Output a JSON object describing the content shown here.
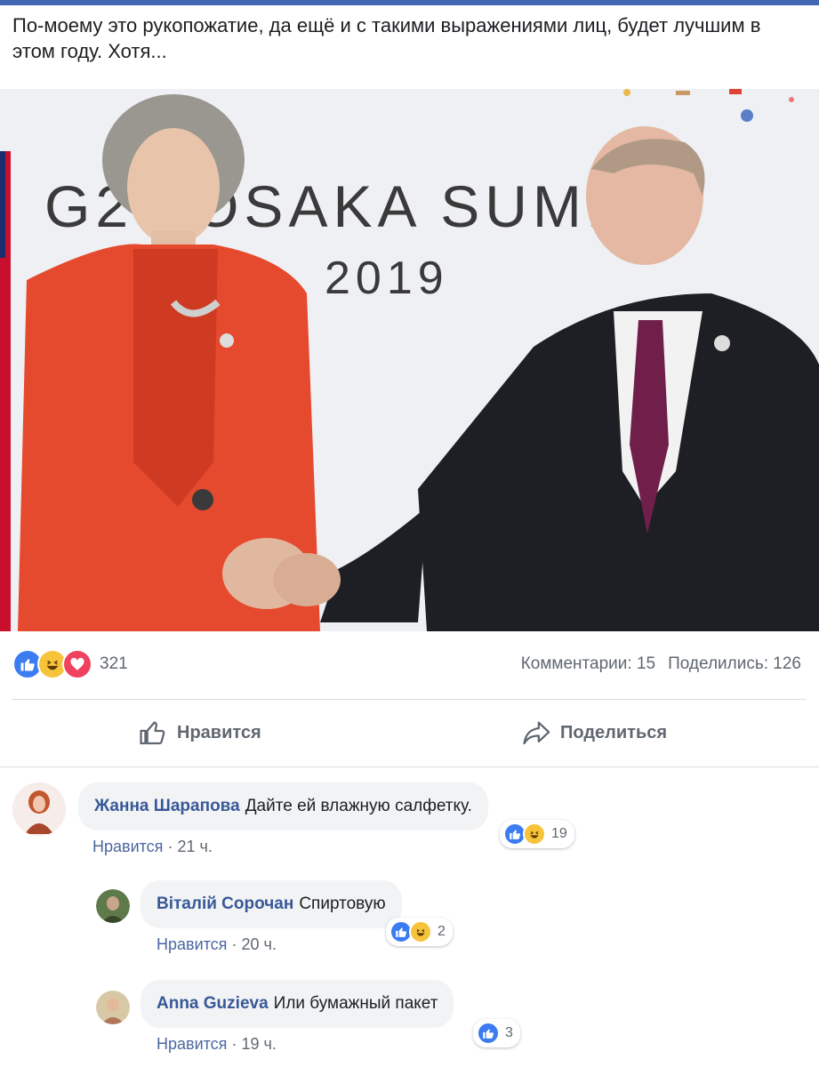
{
  "post": {
    "text": "По-моему это рукопожатие, да ещё и с такими выражениями лиц, будет лучшим в этом году. Хотя...",
    "photo": {
      "banner_line1": "G20 OSAKA SUMMIT",
      "banner_line2": "2019"
    }
  },
  "stats": {
    "reaction_count": "321",
    "comments": "Комментарии: 15",
    "shares": "Поделились: 126"
  },
  "actions": {
    "like_label": "Нравится",
    "share_label": "Поделиться"
  },
  "comments": [
    {
      "author": "Жанна Шарапова",
      "text": "Дайте ей влажную салфетку.",
      "like_link": "Нравится",
      "time": "21 ч.",
      "reaction_count": "19"
    },
    {
      "author": "Віталій Сорочан",
      "text": "Спиртовую",
      "like_link": "Нравится",
      "time": "20 ч.",
      "reaction_count": "2"
    },
    {
      "author": "Anna Guzieva",
      "text": "Или бумажный пакет",
      "like_link": "Нравится",
      "time": "19 ч.",
      "reaction_count": "3"
    }
  ],
  "icons": {
    "reactions": [
      "like-icon",
      "haha-icon",
      "love-icon"
    ],
    "like_action": "thumbs-up-outline-icon",
    "share_action": "share-arrow-icon"
  },
  "colors": {
    "brand": "#4267b2",
    "link": "#385898",
    "like": "#3b7cf0",
    "haha": "#f7c33b",
    "love": "#f0415e"
  }
}
